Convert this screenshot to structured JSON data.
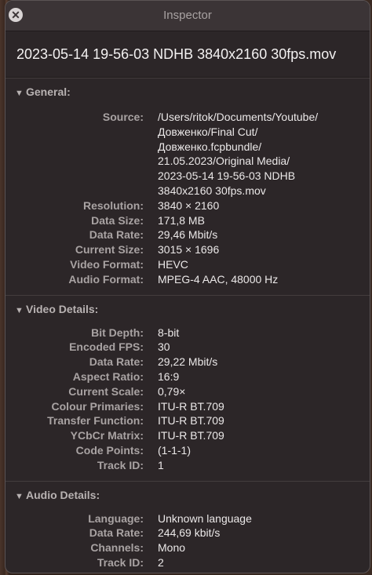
{
  "window": {
    "title": "Inspector"
  },
  "file": {
    "name": "2023-05-14 19-56-03 NDHB 3840x2160 30fps.mov"
  },
  "general": {
    "header": "General:",
    "rows": [
      {
        "label": "Source:",
        "value": "/Users/ritok/Documents/Youtube/\nДовженко/Final Cut/\nДовженко.fcpbundle/\n21.05.2023/Original Media/\n2023-05-14 19-56-03 NDHB\n3840x2160 30fps.mov"
      },
      {
        "label": "Resolution:",
        "value": "3840 × 2160"
      },
      {
        "label": "Data Size:",
        "value": "171,8 MB"
      },
      {
        "label": "Data Rate:",
        "value": "29,46 Mbit/s"
      },
      {
        "label": "Current Size:",
        "value": "3015 × 1696"
      },
      {
        "label": "Video Format:",
        "value": "HEVC"
      },
      {
        "label": "Audio Format:",
        "value": "MPEG-4 AAC, 48000 Hz"
      }
    ]
  },
  "video": {
    "header": "Video Details:",
    "rows": [
      {
        "label": "Bit Depth:",
        "value": "8-bit"
      },
      {
        "label": "Encoded FPS:",
        "value": "30"
      },
      {
        "label": "Data Rate:",
        "value": "29,22 Mbit/s"
      },
      {
        "label": "Aspect Ratio:",
        "value": "16:9"
      },
      {
        "label": "Current Scale:",
        "value": "0,79×"
      },
      {
        "label": "Colour Primaries:",
        "value": "ITU-R BT.709"
      },
      {
        "label": "Transfer Function:",
        "value": "ITU-R BT.709"
      },
      {
        "label": "YCbCr Matrix:",
        "value": "ITU-R BT.709"
      },
      {
        "label": "Code Points:",
        "value": "(1-1-1)"
      },
      {
        "label": "Track ID:",
        "value": "1"
      }
    ]
  },
  "audio": {
    "header": "Audio Details:",
    "rows": [
      {
        "label": "Language:",
        "value": "Unknown language"
      },
      {
        "label": "Data Rate:",
        "value": "244,69 kbit/s"
      },
      {
        "label": "Channels:",
        "value": "Mono"
      },
      {
        "label": "Track ID:",
        "value": "2"
      }
    ]
  }
}
